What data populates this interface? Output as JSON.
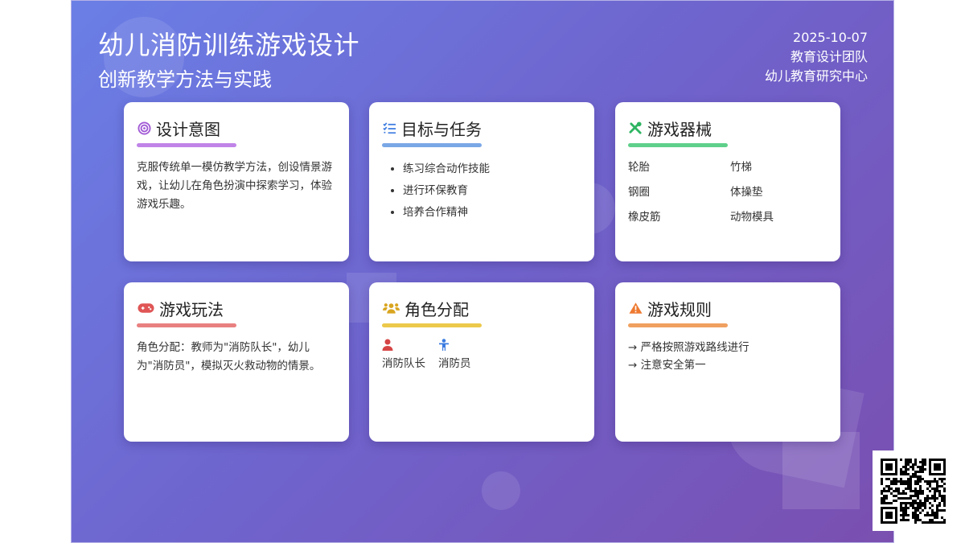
{
  "header": {
    "title": "幼儿消防训练游戏设计",
    "subtitle": "创新教学方法与实践",
    "date": "2025-10-07",
    "team": "教育设计团队",
    "org": "幼儿教育研究中心"
  },
  "cards": {
    "intent": {
      "title": "设计意图",
      "icon": "target-icon",
      "accent": "#c084e8",
      "text": "克服传统单一模仿教学方法，创设情景游戏，让幼儿在角色扮演中探索学习，体验游戏乐趣。"
    },
    "goals": {
      "title": "目标与任务",
      "icon": "checklist-icon",
      "accent": "#7aa7e6",
      "items": [
        "练习综合动作技能",
        "进行环保教育",
        "培养合作精神"
      ]
    },
    "equipment": {
      "title": "游戏器械",
      "icon": "tools-icon",
      "accent": "#5fd08a",
      "items": [
        "轮胎",
        "竹梯",
        "钢圈",
        "体操垫",
        "橡皮筋",
        "动物模具"
      ]
    },
    "gameplay": {
      "title": "游戏玩法",
      "icon": "gamepad-icon",
      "accent": "#e98080",
      "text": "角色分配：教师为\"消防队长\"，幼儿为\"消防员\"，模拟灭火救动物的情景。"
    },
    "roles": {
      "title": "角色分配",
      "icon": "users-icon",
      "accent": "#ecc94b",
      "items": [
        "消防队长",
        "消防员"
      ]
    },
    "rules": {
      "title": "游戏规则",
      "icon": "warning-icon",
      "accent": "#f0a060",
      "items": [
        "→ 严格按照游戏路线进行",
        "→ 注意安全第一"
      ]
    }
  }
}
